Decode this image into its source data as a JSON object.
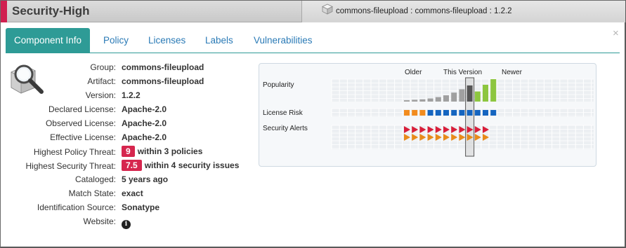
{
  "header": {
    "title": "Security-High",
    "coordinates": "commons-fileupload : commons-fileupload : 1.2.2"
  },
  "tabs": [
    {
      "label": "Component Info",
      "active": true
    },
    {
      "label": "Policy",
      "active": false
    },
    {
      "label": "Licenses",
      "active": false
    },
    {
      "label": "Labels",
      "active": false
    },
    {
      "label": "Vulnerabilities",
      "active": false
    }
  ],
  "info": {
    "group": {
      "label": "Group:",
      "value": "commons-fileupload"
    },
    "artifact": {
      "label": "Artifact:",
      "value": "commons-fileupload"
    },
    "version": {
      "label": "Version:",
      "value": "1.2.2"
    },
    "declared_license": {
      "label": "Declared License:",
      "value": "Apache-2.0"
    },
    "observed_license": {
      "label": "Observed License:",
      "value": "Apache-2.0"
    },
    "effective_license": {
      "label": "Effective License:",
      "value": "Apache-2.0"
    },
    "policy_threat": {
      "label": "Highest Policy Threat:",
      "score": "9",
      "text": "within 3 policies"
    },
    "security_threat": {
      "label": "Highest Security Threat:",
      "score": "7.5",
      "text": "within 4 security issues"
    },
    "cataloged": {
      "label": "Cataloged:",
      "value": "5 years ago"
    },
    "match_state": {
      "label": "Match State:",
      "value": "exact"
    },
    "identification_source": {
      "label": "Identification Source:",
      "value": "Sonatype"
    },
    "website": {
      "label": "Website:"
    }
  },
  "version_graph": {
    "labels": {
      "older": "Older",
      "this": "This Version",
      "newer": "Newer"
    },
    "rows": {
      "popularity": "Popularity",
      "license_risk": "License Risk",
      "security_alerts": "Security Alerts"
    },
    "popularity": [
      0.06,
      0.08,
      0.1,
      0.14,
      0.2,
      0.28,
      0.4,
      0.55,
      0.72,
      0.45,
      0.75,
      1.0
    ],
    "popularity_colors": [
      "#a0a0a0",
      "#a0a0a0",
      "#a0a0a0",
      "#a0a0a0",
      "#a0a0a0",
      "#a0a0a0",
      "#a0a0a0",
      "#a0a0a0",
      "#555555",
      "#8dc63f",
      "#8dc63f",
      "#8dc63f"
    ],
    "license_risk": [
      "orange",
      "orange",
      "orange",
      "blue",
      "blue",
      "blue",
      "blue",
      "blue",
      "blue",
      "blue",
      "blue",
      "blue"
    ],
    "security_alerts_red": 11,
    "security_alerts_orange": 11,
    "current_index": 8,
    "colors": {
      "orange": "#f28c1e",
      "blue": "#1565c0",
      "red": "#d81e3a",
      "alert_orange": "#e88a1a"
    }
  }
}
